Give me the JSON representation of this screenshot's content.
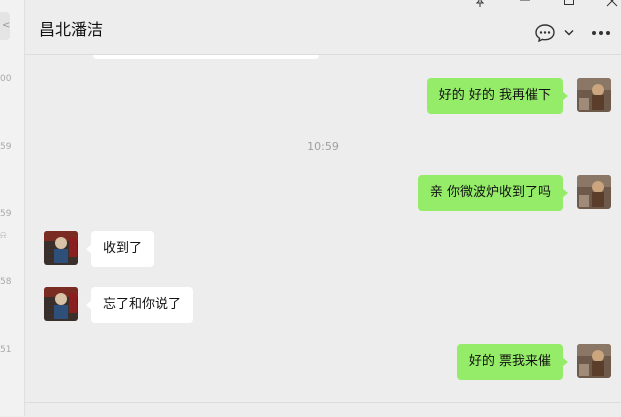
{
  "chat": {
    "title": "昌北潘洁"
  },
  "sidebar_fragments": {
    "times": [
      "00",
      "59",
      "59",
      "58",
      "51"
    ]
  },
  "window_controls": [
    "pin-icon",
    "minimize-icon",
    "maximize-icon",
    "close-icon"
  ],
  "header_icons": [
    "chat-bubble-icon",
    "chevron-down-icon",
    "more-icon"
  ],
  "messages": [
    {
      "sender": "me",
      "text": "好的 好的 我再催下"
    },
    {
      "type": "timestamp",
      "text": "10:59"
    },
    {
      "sender": "me",
      "text": "亲 你微波炉收到了吗"
    },
    {
      "sender": "them",
      "text": "收到了"
    },
    {
      "sender": "them",
      "text": "忘了和你说了"
    },
    {
      "sender": "me",
      "text": "好的 票我来催"
    }
  ],
  "colors": {
    "my_bubble": "#95ec69",
    "their_bubble": "#ffffff",
    "background": "#ededed"
  }
}
